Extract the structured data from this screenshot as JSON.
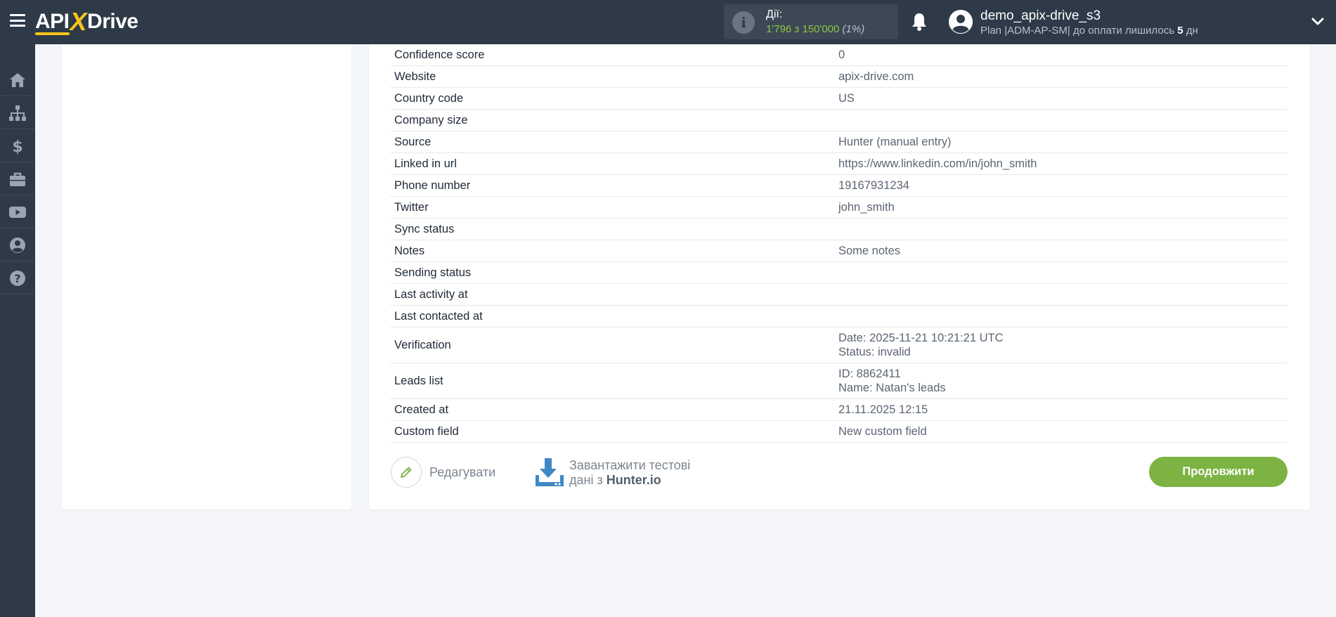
{
  "header": {
    "logo": {
      "api": "API",
      "x": "X",
      "drive": "Drive"
    },
    "actions": {
      "label": "Дії:",
      "count": "1'796 з 150'000",
      "percent": "(1%)"
    },
    "user": {
      "name": "demo_apix-drive_s3",
      "plan_prefix": "Plan |ADM-AP-SM| до оплати лишилось ",
      "days": "5",
      "plan_suffix": " дн"
    }
  },
  "sidebar": {
    "items": [
      {
        "icon": "home-icon"
      },
      {
        "icon": "sitemap-icon"
      },
      {
        "icon": "dollar-icon"
      },
      {
        "icon": "briefcase-icon"
      },
      {
        "icon": "youtube-icon"
      },
      {
        "icon": "user-circle-icon"
      },
      {
        "icon": "question-icon"
      }
    ]
  },
  "rows": [
    {
      "key": "Confidence score",
      "value": "0"
    },
    {
      "key": "Website",
      "value": "apix-drive.com"
    },
    {
      "key": "Country code",
      "value": "US"
    },
    {
      "key": "Company size",
      "value": ""
    },
    {
      "key": "Source",
      "value": "Hunter (manual entry)"
    },
    {
      "key": "Linked in url",
      "value": "https://www.linkedin.com/in/john_smith"
    },
    {
      "key": "Phone number",
      "value": "19167931234"
    },
    {
      "key": "Twitter",
      "value": "john_smith"
    },
    {
      "key": "Sync status",
      "value": ""
    },
    {
      "key": "Notes",
      "value": "Some notes"
    },
    {
      "key": "Sending status",
      "value": ""
    },
    {
      "key": "Last activity at",
      "value": ""
    },
    {
      "key": "Last contacted at",
      "value": ""
    },
    {
      "key": "Verification",
      "value1": "Date: 2025-11-21 10:21:21 UTC",
      "value2": "Status: invalid"
    },
    {
      "key": "Leads list",
      "value1": "ID: 8862411",
      "value2": "Name: Natan's leads"
    },
    {
      "key": "Created at",
      "value": "21.11.2025 12:15"
    },
    {
      "key": "Custom field",
      "value": "New custom field"
    }
  ],
  "footer": {
    "edit_label": "Редагувати",
    "download_line1": "Завантажити тестові",
    "download_line2_prefix": "дані з ",
    "download_source": "Hunter.io",
    "continue_label": "Продовжити"
  },
  "colors": {
    "topbar": "#2e3a48",
    "accent_green": "#7cb342",
    "logo_yellow": "#f5c518",
    "download_blue": "#3f88c5"
  }
}
